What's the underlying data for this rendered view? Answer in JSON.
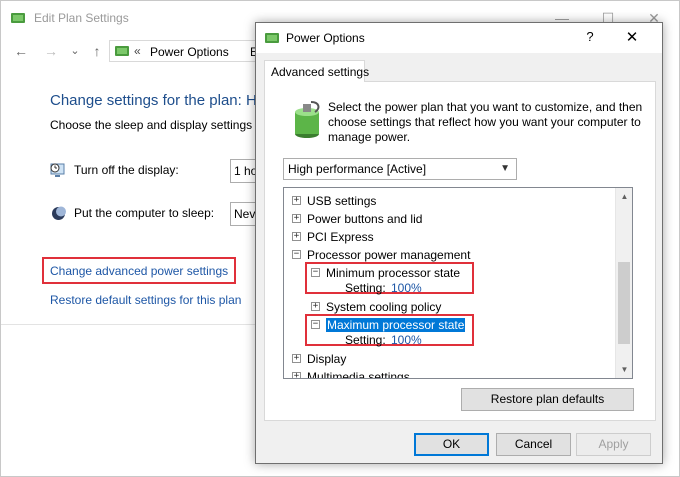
{
  "background_window": {
    "title": "Edit Plan Settings",
    "address_crumb_chevron": "«",
    "address_text": "Power Options",
    "address_next": "E",
    "heading": "Change settings for the plan: H",
    "subheading": "Choose the sleep and display settings th",
    "display_label": "Turn off the display:",
    "display_value": "1 ho",
    "sleep_label": "Put the computer to sleep:",
    "sleep_value": "Neve",
    "advanced_link": "Change advanced power settings",
    "restore_link": "Restore default settings for this plan",
    "caption_min": "—",
    "caption_max": "☐",
    "caption_close": "✕",
    "nav_back": "←",
    "nav_forward": "→",
    "nav_recent": "⌄",
    "nav_up": "↑"
  },
  "dialog": {
    "title": "Power Options",
    "help_label": "?",
    "close_label": "✕",
    "tab_label": "Advanced settings",
    "description": "Select the power plan that you want to customize, and then choose settings that reflect how you want your computer to manage power.",
    "plan_selected": "High performance [Active]",
    "tree": {
      "usb": "USB settings",
      "power_buttons": "Power buttons and lid",
      "pci": "PCI Express",
      "processor": "Processor power management",
      "min_state": "Minimum processor state",
      "min_setting_label": "Setting:",
      "min_setting_value": "100%",
      "cooling": "System cooling policy",
      "max_state": "Maximum processor state",
      "max_setting_label": "Setting:",
      "max_setting_value": "100%",
      "display": "Display",
      "multimedia": "Multimedia settings",
      "toggle_plus": "+",
      "toggle_minus": "−"
    },
    "restore_button": "Restore plan defaults",
    "ok_button": "OK",
    "cancel_button": "Cancel",
    "apply_button": "Apply"
  },
  "colors": {
    "link": "#1e57a6",
    "heading": "#1e4e8c",
    "highlight": "#e0303a",
    "selection": "#0078d7"
  }
}
